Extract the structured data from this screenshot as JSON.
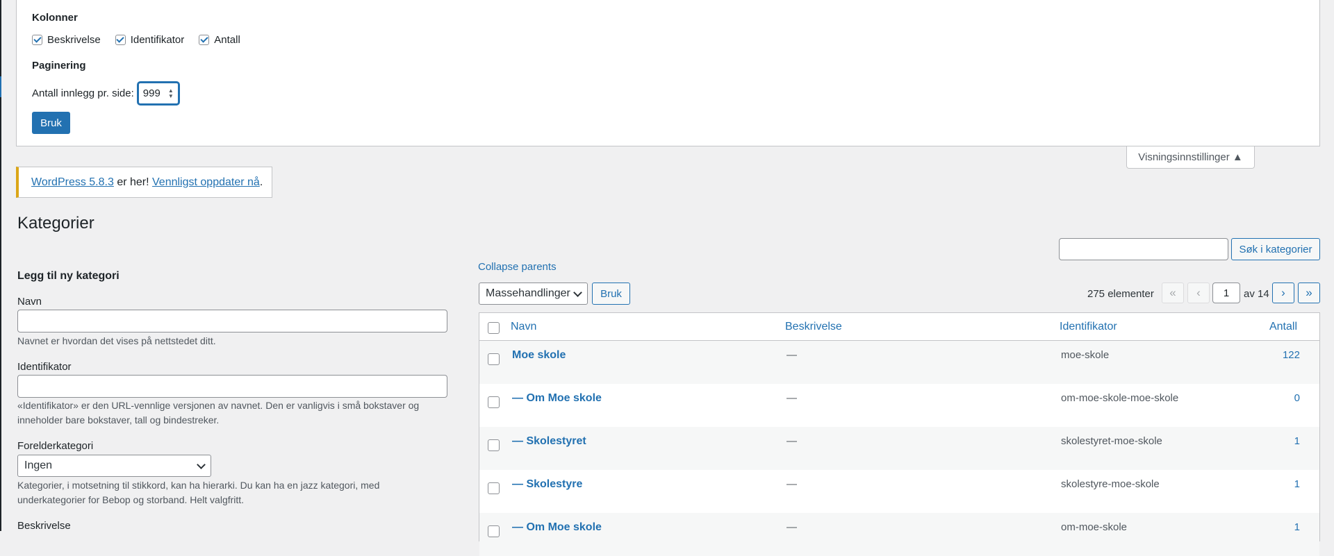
{
  "screen_options": {
    "columns_heading": "Kolonner",
    "columns": [
      {
        "label": "Beskrivelse",
        "checked": true
      },
      {
        "label": "Identifikator",
        "checked": true
      },
      {
        "label": "Antall",
        "checked": true
      }
    ],
    "pagination_heading": "Paginering",
    "per_page_label": "Antall innlegg pr. side:",
    "per_page_value": "999",
    "apply_label": "Bruk",
    "toggle_label": "Visningsinnstillinger ▲"
  },
  "notice": {
    "link1": "WordPress 5.8.3",
    "text": " er her! ",
    "link2": "Vennligst oppdater nå",
    "end": "."
  },
  "page_title": "Kategorier",
  "search": {
    "button_label": "Søk i kategorier",
    "value": ""
  },
  "add_form": {
    "heading": "Legg til ny kategori",
    "name_label": "Navn",
    "name_help": "Navnet er hvordan det vises på nettstedet ditt.",
    "slug_label": "Identifikator",
    "slug_help": "«Identifikator» er den URL-vennlige versjonen av navnet. Den er vanligvis i små bokstaver og inneholder bare bokstaver, tall og bindestreker.",
    "parent_label": "Forelderkategori",
    "parent_value": "Ingen",
    "parent_help": "Kategorier, i motsetning til stikkord, kan ha hierarki. Du kan ha en jazz kategori, med underkategorier for Bebop og storband. Helt valgfritt.",
    "description_label": "Beskrivelse"
  },
  "list": {
    "collapse_label": "Collapse parents",
    "bulk_actions": "Massehandlinger",
    "bulk_apply": "Bruk",
    "item_count": "275 elementer",
    "pagination": {
      "first": "«",
      "prev": "‹",
      "current": "1",
      "of_label": "av 14",
      "next": "›",
      "last": "»"
    },
    "headers": {
      "name": "Navn",
      "description": "Beskrivelse",
      "slug": "Identifikator",
      "count": "Antall"
    },
    "rows": [
      {
        "name": "Moe skole",
        "description": "—",
        "slug": "moe-skole",
        "count": "122"
      },
      {
        "name": "— Om Moe skole",
        "description": "—",
        "slug": "om-moe-skole-moe-skole",
        "count": "0"
      },
      {
        "name": "— Skolestyret",
        "description": "—",
        "slug": "skolestyret-moe-skole",
        "count": "1"
      },
      {
        "name": "— Skolestyre",
        "description": "—",
        "slug": "skolestyre-moe-skole",
        "count": "1"
      },
      {
        "name": "— Om Moe skole",
        "description": "—",
        "slug": "om-moe-skole",
        "count": "1"
      }
    ]
  }
}
